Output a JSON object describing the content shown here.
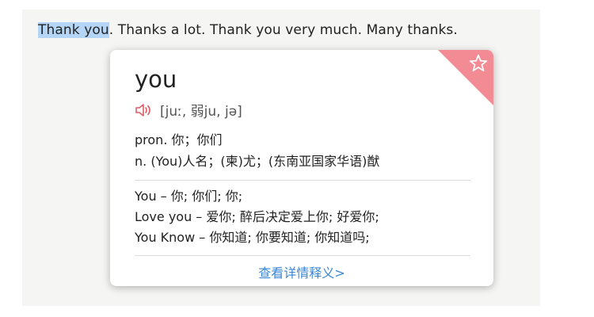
{
  "sentence": {
    "selected": "Thank you",
    "rest": ". Thanks a lot. Thank you very much. Many thanks."
  },
  "popup": {
    "word": "you",
    "phonetic": "[juː, 弱ju, jə]",
    "definitions": [
      "pron. 你；你们",
      "n. (You)人名；(柬)尤；(东南亚国家华语)猷"
    ],
    "phrases": [
      "You – 你; 你们; 你;",
      "Love you – 爱你; 醉后决定爱上你; 好爱你;",
      "You Know – 你知道; 你要知道; 你知道吗;"
    ],
    "more_link": "查看详情释义>",
    "icons": {
      "favorite": "star-icon",
      "pronounce": "speaker-icon"
    },
    "colors": {
      "accent": "#f28b93",
      "link": "#3a86d4",
      "selection": "#b4d5f5"
    }
  }
}
